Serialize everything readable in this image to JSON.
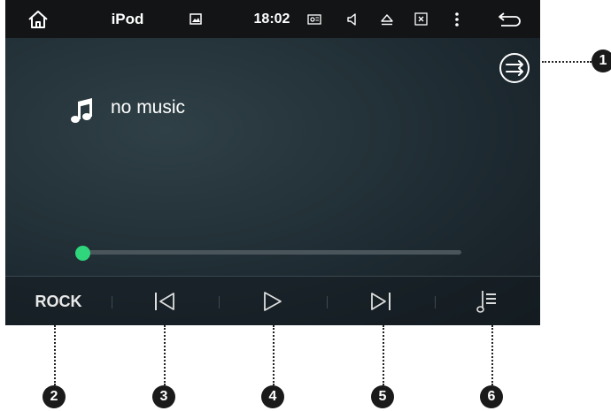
{
  "statusbar": {
    "title": "iPod",
    "time": "18:02",
    "icons": [
      "home-icon",
      "gallery-icon",
      "radio-icon",
      "volume-icon",
      "eject-icon",
      "close-box-icon",
      "menu-dots-icon",
      "back-arrow-icon"
    ]
  },
  "player": {
    "track_title": "no music",
    "progress_fraction": 0.0,
    "icons": [
      "shuffle-icon",
      "music-note-icon"
    ]
  },
  "controls": {
    "eq_label": "ROCK",
    "icons": [
      "previous-icon",
      "play-icon",
      "next-icon",
      "playlist-icon"
    ]
  },
  "callouts": [
    "1",
    "2",
    "3",
    "4",
    "5",
    "6"
  ],
  "colors": {
    "progress_knob": "#2fd67c",
    "statusbar_bg": "#121416",
    "screen_bg": "#1f2c33"
  }
}
